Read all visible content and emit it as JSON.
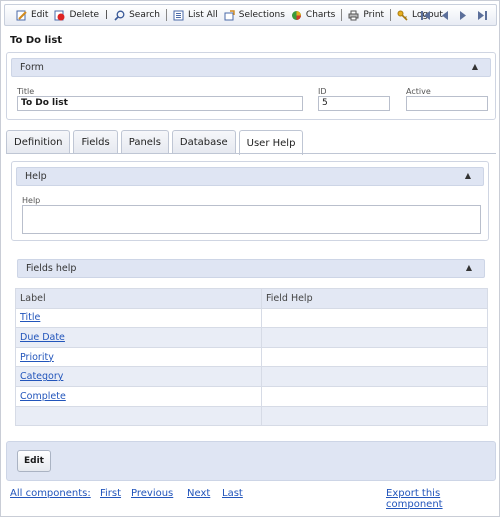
{
  "toolbar": {
    "edit": "Edit",
    "delete": "Delete",
    "search": "Search",
    "list_all": "List All",
    "selections": "Selections",
    "charts": "Charts",
    "print": "Print",
    "logout": "Logout",
    "separator": "|"
  },
  "page_title": "To Do list",
  "form_panel": {
    "title": "Form",
    "title_label": "Title",
    "title_value": "To Do list",
    "id_label": "ID",
    "id_value": "5",
    "active_label": "Active",
    "active_value": ""
  },
  "tabs": [
    "Definition",
    "Fields",
    "Panels",
    "Database",
    "User Help"
  ],
  "help_panel": {
    "title": "Help",
    "help_label": "Help",
    "help_value": ""
  },
  "fields_help_panel": {
    "title": "Fields help",
    "columns": [
      "Label",
      "Field Help"
    ],
    "rows": [
      {
        "label": "Title",
        "help": ""
      },
      {
        "label": "Due Date",
        "help": ""
      },
      {
        "label": "Priority",
        "help": ""
      },
      {
        "label": "Category",
        "help": ""
      },
      {
        "label": "Complete",
        "help": ""
      },
      {
        "label": "",
        "help": ""
      }
    ]
  },
  "footer": {
    "edit_button": "Edit",
    "all_components": "All components:",
    "first": "First",
    "previous": "Previous",
    "next": "Next",
    "last": "Last",
    "export": "Export this component"
  },
  "icons": {
    "collapse": "caret-up-icon",
    "nav": [
      "first-record-icon",
      "previous-record-icon",
      "next-record-icon",
      "last-record-icon"
    ]
  },
  "colors": {
    "link": "#2255bb",
    "panel_header": "#dfe5f3",
    "row_alt": "#e9edf6"
  }
}
